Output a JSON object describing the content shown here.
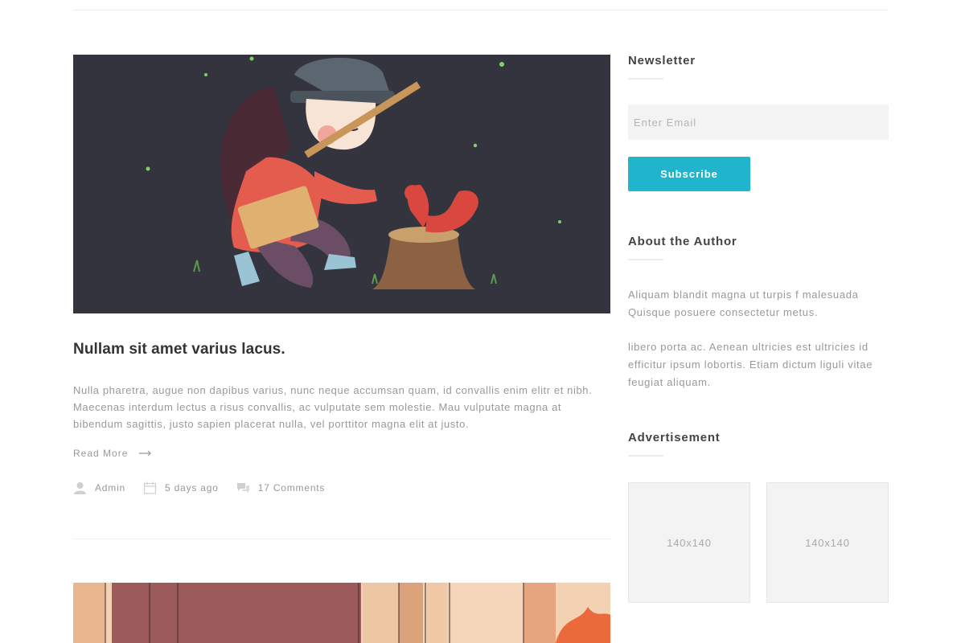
{
  "post": {
    "title": "Nullam sit amet varius lacus.",
    "excerpt": "Nulla pharetra, augue non dapibus varius, nunc neque accumsan quam, id convallis enim elitr et nibh. Maecenas interdum lectus a risus convallis, ac vulputate sem molestie. Mau vulputate magna at bibendum sagittis, justo sapien placerat nulla, vel porttitor magna elit at justo.",
    "read_more": "Read More",
    "meta": {
      "author": "Admin",
      "date": "5 days ago",
      "comments": "17 Comments"
    }
  },
  "sidebar": {
    "newsletter": {
      "title": "Newsletter",
      "email_placeholder": "Enter Email",
      "subscribe_label": "Subscribe"
    },
    "about": {
      "title": "About the Author",
      "paragraph_1": "Aliquam blandit magna ut turpis f malesuada Quisque posuere consectetur metus.",
      "paragraph_2": "libero porta ac. Aenean ultricies est ultricies id efficitur ipsum lobortis. Etiam dictum liguli vitae feugiat aliquam."
    },
    "advertisement": {
      "title": "Advertisement",
      "ads": [
        "140x140",
        "140x140"
      ]
    }
  },
  "colors": {
    "accent": "#1fb5cc",
    "text_muted": "#999999",
    "image_background": "#34343f"
  },
  "icons": {
    "author": "user-icon",
    "date": "calendar-icon",
    "comments": "comments-icon",
    "read_more": "arrow-right-icon"
  }
}
